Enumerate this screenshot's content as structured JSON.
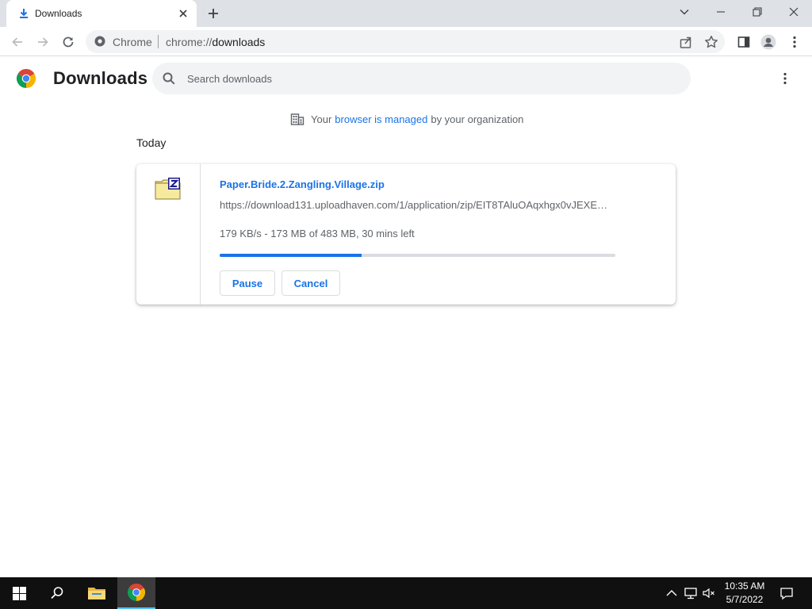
{
  "tab": {
    "title": "Downloads",
    "icon": "download-arrow-icon"
  },
  "omnibox": {
    "site_label": "Chrome",
    "url_scheme": "chrome://",
    "url_path": "downloads"
  },
  "page": {
    "title": "Downloads",
    "search_placeholder": "Search downloads",
    "managed": {
      "prefix": "Your",
      "link": "browser is managed",
      "suffix": "by your organization"
    },
    "section_date": "Today"
  },
  "download": {
    "file_name": "Paper.Bride.2.Zangling.Village.zip",
    "url": "https://download131.uploadhaven.com/1/application/zip/EIT8TAluOAqxhgx0vJEXE…",
    "status": "179 KB/s - 173 MB of 483 MB, 30 mins left",
    "progress_fraction": 0.358,
    "pause_label": "Pause",
    "cancel_label": "Cancel"
  },
  "taskbar": {
    "time": "10:35 AM",
    "date": "5/7/2022"
  },
  "colors": {
    "accent": "#1a73e8",
    "tabstrip": "#dee1e6",
    "taskbar": "#101010"
  }
}
